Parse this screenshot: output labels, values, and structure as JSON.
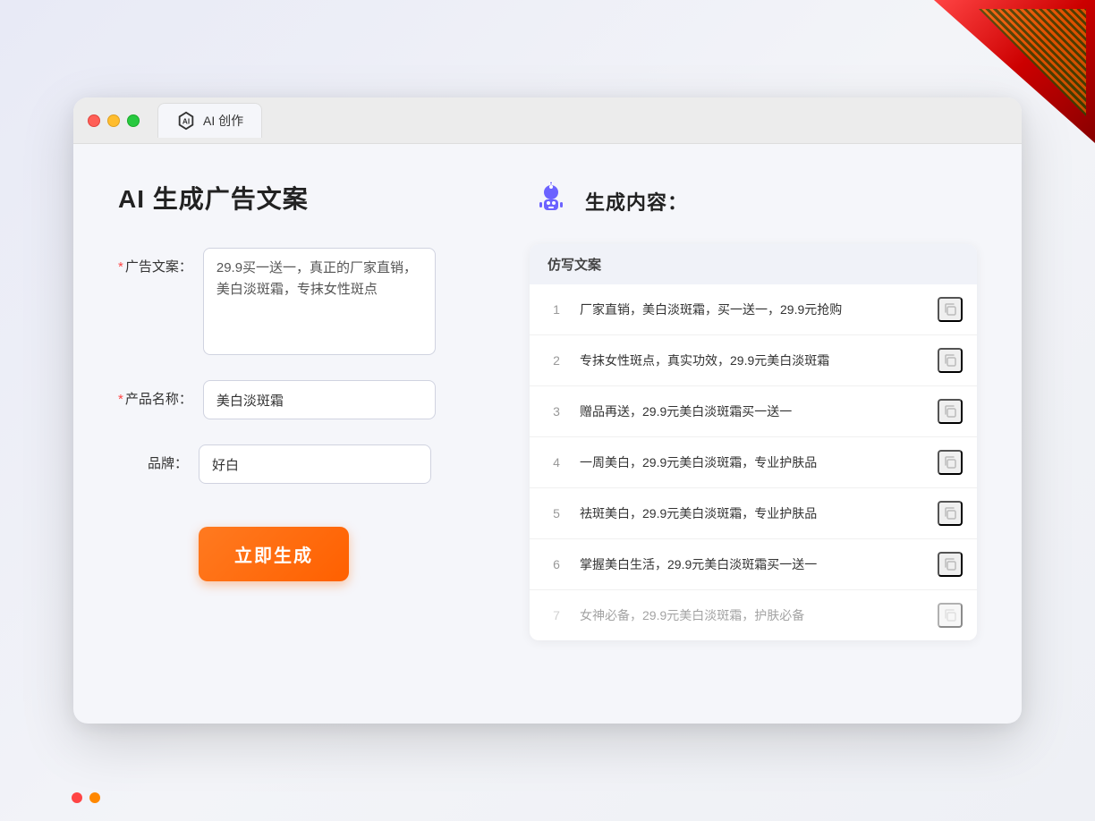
{
  "app": {
    "tab_label": "AI 创作"
  },
  "page": {
    "title": "AI 生成广告文案"
  },
  "form": {
    "ad_copy_label": "广告文案：",
    "ad_copy_required": "*",
    "ad_copy_value": "29.9买一送一，真正的厂家直销，美白淡斑霜，专抹女性斑点",
    "product_name_label": "产品名称：",
    "product_name_required": "*",
    "product_name_value": "美白淡斑霜",
    "brand_label": "品牌：",
    "brand_value": "好白",
    "generate_button": "立即生成"
  },
  "result": {
    "section_title": "生成内容：",
    "table_header": "仿写文案",
    "items": [
      {
        "num": "1",
        "text": "厂家直销，美白淡斑霜，买一送一，29.9元抢购"
      },
      {
        "num": "2",
        "text": "专抹女性斑点，真实功效，29.9元美白淡斑霜"
      },
      {
        "num": "3",
        "text": "赠品再送，29.9元美白淡斑霜买一送一"
      },
      {
        "num": "4",
        "text": "一周美白，29.9元美白淡斑霜，专业护肤品"
      },
      {
        "num": "5",
        "text": "祛斑美白，29.9元美白淡斑霜，专业护肤品"
      },
      {
        "num": "6",
        "text": "掌握美白生活，29.9元美白淡斑霜买一送一"
      },
      {
        "num": "7",
        "text": "女神必备，29.9元美白淡斑霜，护肤必备",
        "faded": true
      }
    ]
  },
  "icons": {
    "copy": "⧉",
    "robot_emoji": "🤖"
  }
}
